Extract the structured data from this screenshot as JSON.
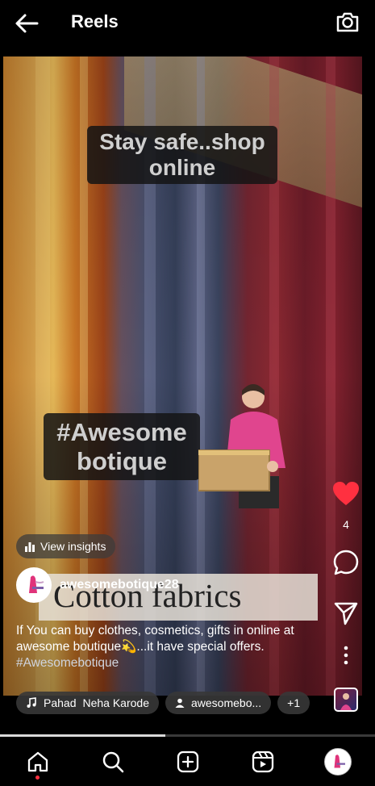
{
  "header": {
    "title": "Reels"
  },
  "video": {
    "overlay_top": "Stay safe..shop online",
    "overlay_middle": "#Awesome botique",
    "banner_text": "Cotton fabrics"
  },
  "insights": {
    "label": "View insights"
  },
  "author": {
    "username": "awesomebotique28"
  },
  "caption": {
    "text": "If You can buy clothes, cosmetics, gifts in online at awesome boutique💫...it have special offers.",
    "hashtag": "#Awesomebotique"
  },
  "actions": {
    "like_count": "4",
    "like_color": "#ff3040"
  },
  "music": {
    "song": "Pahad",
    "artist": "Neha Karode",
    "audio_user": "awesomebo...",
    "more": "+1"
  },
  "progress": {
    "fraction": 0.44
  },
  "nav": {
    "items": [
      "home-icon",
      "search-icon",
      "create-icon",
      "reels-icon",
      "profile-avatar"
    ]
  }
}
